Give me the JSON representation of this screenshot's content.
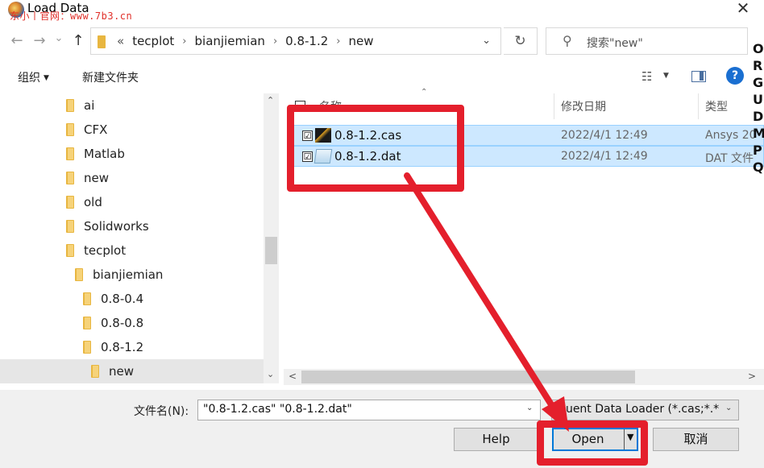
{
  "window": {
    "title": "Load Data",
    "watermark": "东小丨官网：www.7b3.cn",
    "close_glyph": "✕"
  },
  "nav": {
    "back_glyph": "←",
    "forward_glyph": "→",
    "history_glyph": "⌄",
    "up_glyph": "↑",
    "lead": "«",
    "breadcrumbs": [
      "tecplot",
      "bianjiemian",
      "0.8-1.2",
      "new"
    ],
    "sep": "›",
    "dropdown_glyph": "⌄",
    "refresh_glyph": "↻",
    "search_icon_glyph": "⚲",
    "search_placeholder": "搜索\"new\""
  },
  "toolbar": {
    "organize": "组织",
    "organize_arrow": "▼",
    "new_folder": "新建文件夹",
    "view_glyph": "☷",
    "view_dd": "▼",
    "help_glyph": "?"
  },
  "tree": {
    "items": [
      {
        "label": "ai"
      },
      {
        "label": "CFX"
      },
      {
        "label": "Matlab"
      },
      {
        "label": "new"
      },
      {
        "label": "old"
      },
      {
        "label": "Solidworks"
      },
      {
        "label": "tecplot"
      },
      {
        "label": "bianjiemian"
      },
      {
        "label": "0.8-0.4"
      },
      {
        "label": "0.8-0.8"
      },
      {
        "label": "0.8-1.2"
      },
      {
        "label": "new"
      }
    ],
    "scroll_up": "⌃",
    "scroll_down": "⌄"
  },
  "filelist": {
    "headers": {
      "name": "名称",
      "date": "修改日期",
      "type": "类型"
    },
    "sort_glyph": "⌃",
    "rows": [
      {
        "name": "0.8-1.2.cas",
        "date": "2022/4/1 12:49",
        "type": "Ansys 20",
        "checked": "☑"
      },
      {
        "name": "0.8-1.2.dat",
        "date": "2022/4/1 12:49",
        "type": "DAT 文件",
        "checked": "☑"
      }
    ],
    "hscroll_left": "<",
    "hscroll_right": ">"
  },
  "bottom": {
    "filename_label": "文件名(N):",
    "filename_value": "\"0.8-1.2.cas\" \"0.8-1.2.dat\"",
    "filename_dd": "⌄",
    "filetype": "Fluent Data Loader (*.cas;*.*",
    "filetype_dd": "⌄",
    "help": "Help",
    "open": "Open",
    "open_arrow": "▼",
    "cancel": "取消"
  },
  "background_strip": [
    "O",
    "R",
    "G",
    "U",
    "D",
    "M",
    "P",
    "Q"
  ],
  "colors": {
    "accent": "#0078d7",
    "selection": "#cde8ff",
    "annotation": "#e41f2c"
  }
}
